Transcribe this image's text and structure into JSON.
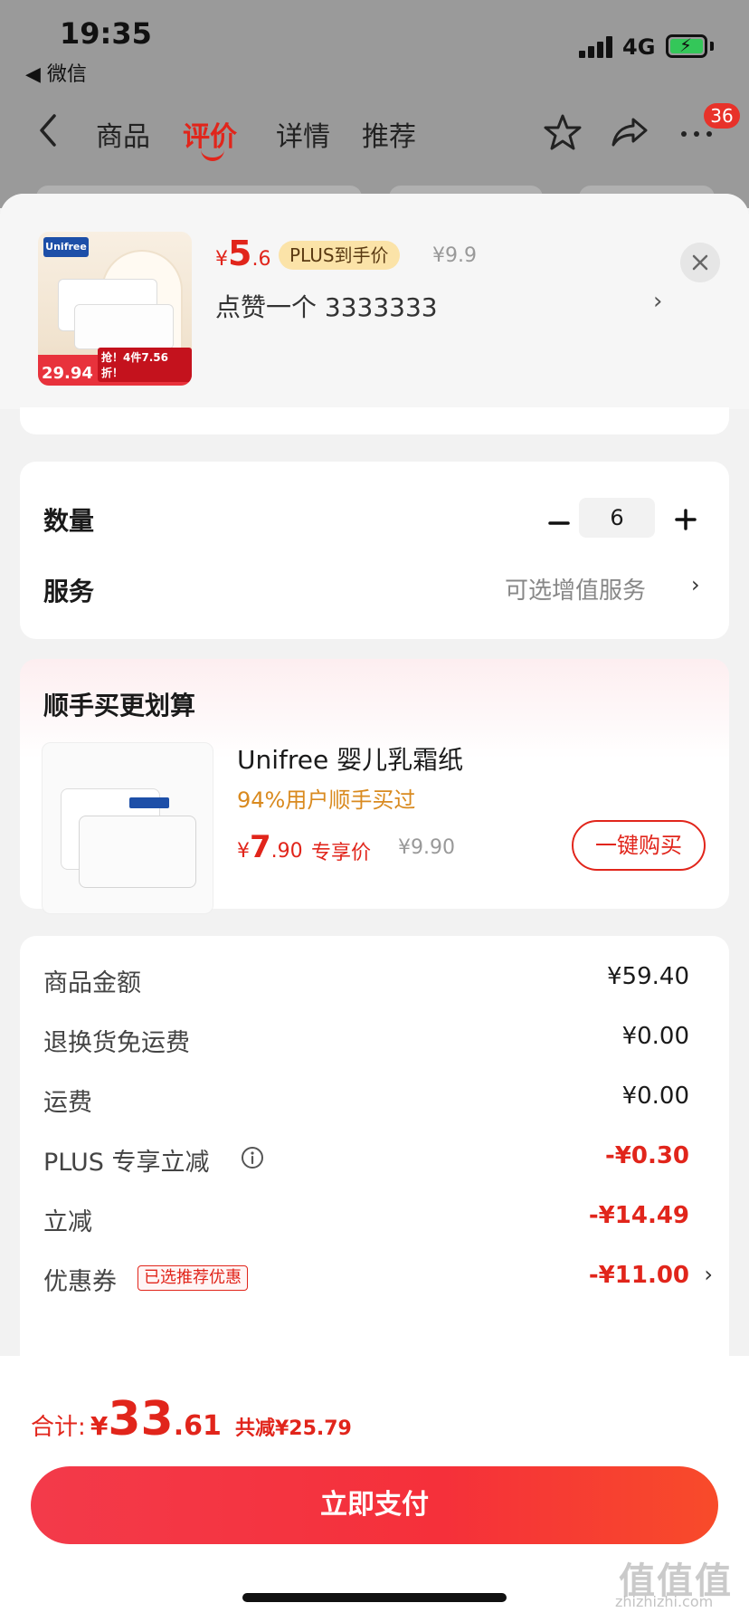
{
  "status_bar": {
    "time": "19:35",
    "back_app": "◀ 微信",
    "network": "4G"
  },
  "nav": {
    "tabs": [
      {
        "label": "商品",
        "active": false
      },
      {
        "label": "评价",
        "active": true
      },
      {
        "label": "详情",
        "active": false
      },
      {
        "label": "推荐",
        "active": false
      }
    ],
    "more_badge": "36"
  },
  "product": {
    "brand_logo": "Unifree",
    "thumb_price": "29.94",
    "thumb_promo": "抢！4件7.56折！",
    "price_symbol": "¥",
    "price_int": "5",
    "price_dec": ".6",
    "plus_tag": "PLUS到手价",
    "old_price": "¥9.9",
    "spec": "点赞一个  3333333"
  },
  "quantity": {
    "label": "数量",
    "value": "6"
  },
  "service": {
    "label": "服务",
    "value": "可选增值服务"
  },
  "bundle": {
    "title": "顺手买更划算",
    "name": "Unifree 婴儿乳霜纸",
    "subtitle": "94%用户顺手买过",
    "price_symbol": "¥",
    "price_int": "7",
    "price_dec": ".90",
    "exclusive": "专享价",
    "old_price": "¥9.90",
    "buy_label": "一键购买"
  },
  "fees": {
    "goods_label": "商品金额",
    "goods_value": "¥59.40",
    "return_label": "退换货免运费",
    "return_value": "¥0.00",
    "shipping_label": "运费",
    "shipping_value": "¥0.00",
    "plus_label": "PLUS 专享立减",
    "plus_value": "-¥0.30",
    "discount_label": "立减",
    "discount_value": "-¥14.49",
    "coupon_label": "优惠券",
    "coupon_tag": "已选推荐优惠",
    "coupon_value": "-¥11.00"
  },
  "footer": {
    "total_label": "合计:",
    "total_symbol": "¥",
    "total_int": "33",
    "total_dec": ".61",
    "saved": "共减¥25.79",
    "pay_label": "立即支付"
  },
  "watermark": {
    "text": "值值值",
    "sub": "zhizhizhi.com"
  },
  "colors": {
    "accent": "#e1251b",
    "plus_tag_bg": "#fbe3a8",
    "bundle_sub": "#d98a1f"
  }
}
